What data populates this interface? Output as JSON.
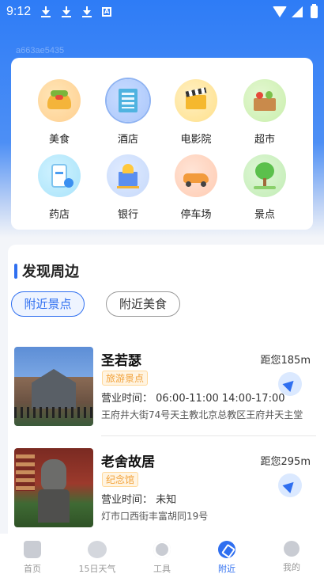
{
  "status_bar": {
    "time": "9:12"
  },
  "ghost_text": "a663ae5435",
  "categories": [
    {
      "label": "美食"
    },
    {
      "label": "酒店"
    },
    {
      "label": "电影院"
    },
    {
      "label": "超市"
    },
    {
      "label": "药店"
    },
    {
      "label": "银行"
    },
    {
      "label": "停车场"
    },
    {
      "label": "景点"
    }
  ],
  "discover": {
    "title": "发现周边",
    "chips": [
      {
        "label": "附近景点"
      },
      {
        "label": "附近美食"
      }
    ],
    "items": [
      {
        "name": "圣若瑟",
        "distance": "距您185m",
        "tag": "旅游景点",
        "hours": "营业时间：    06:00-11:00 14:00-17:00",
        "address": "王府井大街74号天主教北京总教区王府井天主堂"
      },
      {
        "name": "老舍故居",
        "distance": "距您295m",
        "tag": "纪念馆",
        "hours": "营业时间：    未知",
        "address": "灯市口西街丰富胡同19号"
      }
    ]
  },
  "tabbar": [
    {
      "label": "首页"
    },
    {
      "label": "15日天气"
    },
    {
      "label": "工具"
    },
    {
      "label": "附近"
    },
    {
      "label": "我的"
    }
  ]
}
